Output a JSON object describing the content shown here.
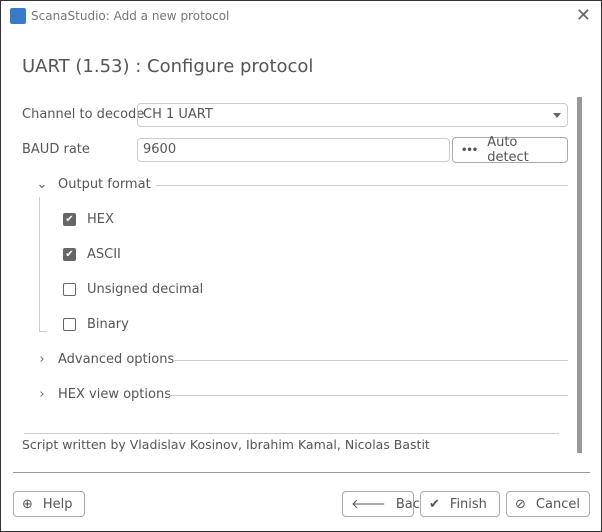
{
  "window": {
    "title": "ScanaStudio: Add a new protocol"
  },
  "heading": "UART (1.53) : Configure protocol",
  "channel": {
    "label": "Channel to decode",
    "value": "CH 1 UART"
  },
  "baud": {
    "label": "BAUD rate",
    "value": "9600",
    "auto_detect": "Auto detect"
  },
  "output_format": {
    "label": "Output format",
    "options": [
      {
        "label": "HEX",
        "checked": true
      },
      {
        "label": "ASCII",
        "checked": true
      },
      {
        "label": "Unsigned decimal",
        "checked": false
      },
      {
        "label": "Binary",
        "checked": false
      }
    ]
  },
  "advanced": "Advanced options",
  "hexview": "HEX view options",
  "credit": "Script written by Vladislav Kosinov, Ibrahim Kamal, Nicolas Bastit",
  "buttons": {
    "help": "Help",
    "back": "Back",
    "finish": "Finish",
    "cancel": "Cancel"
  }
}
